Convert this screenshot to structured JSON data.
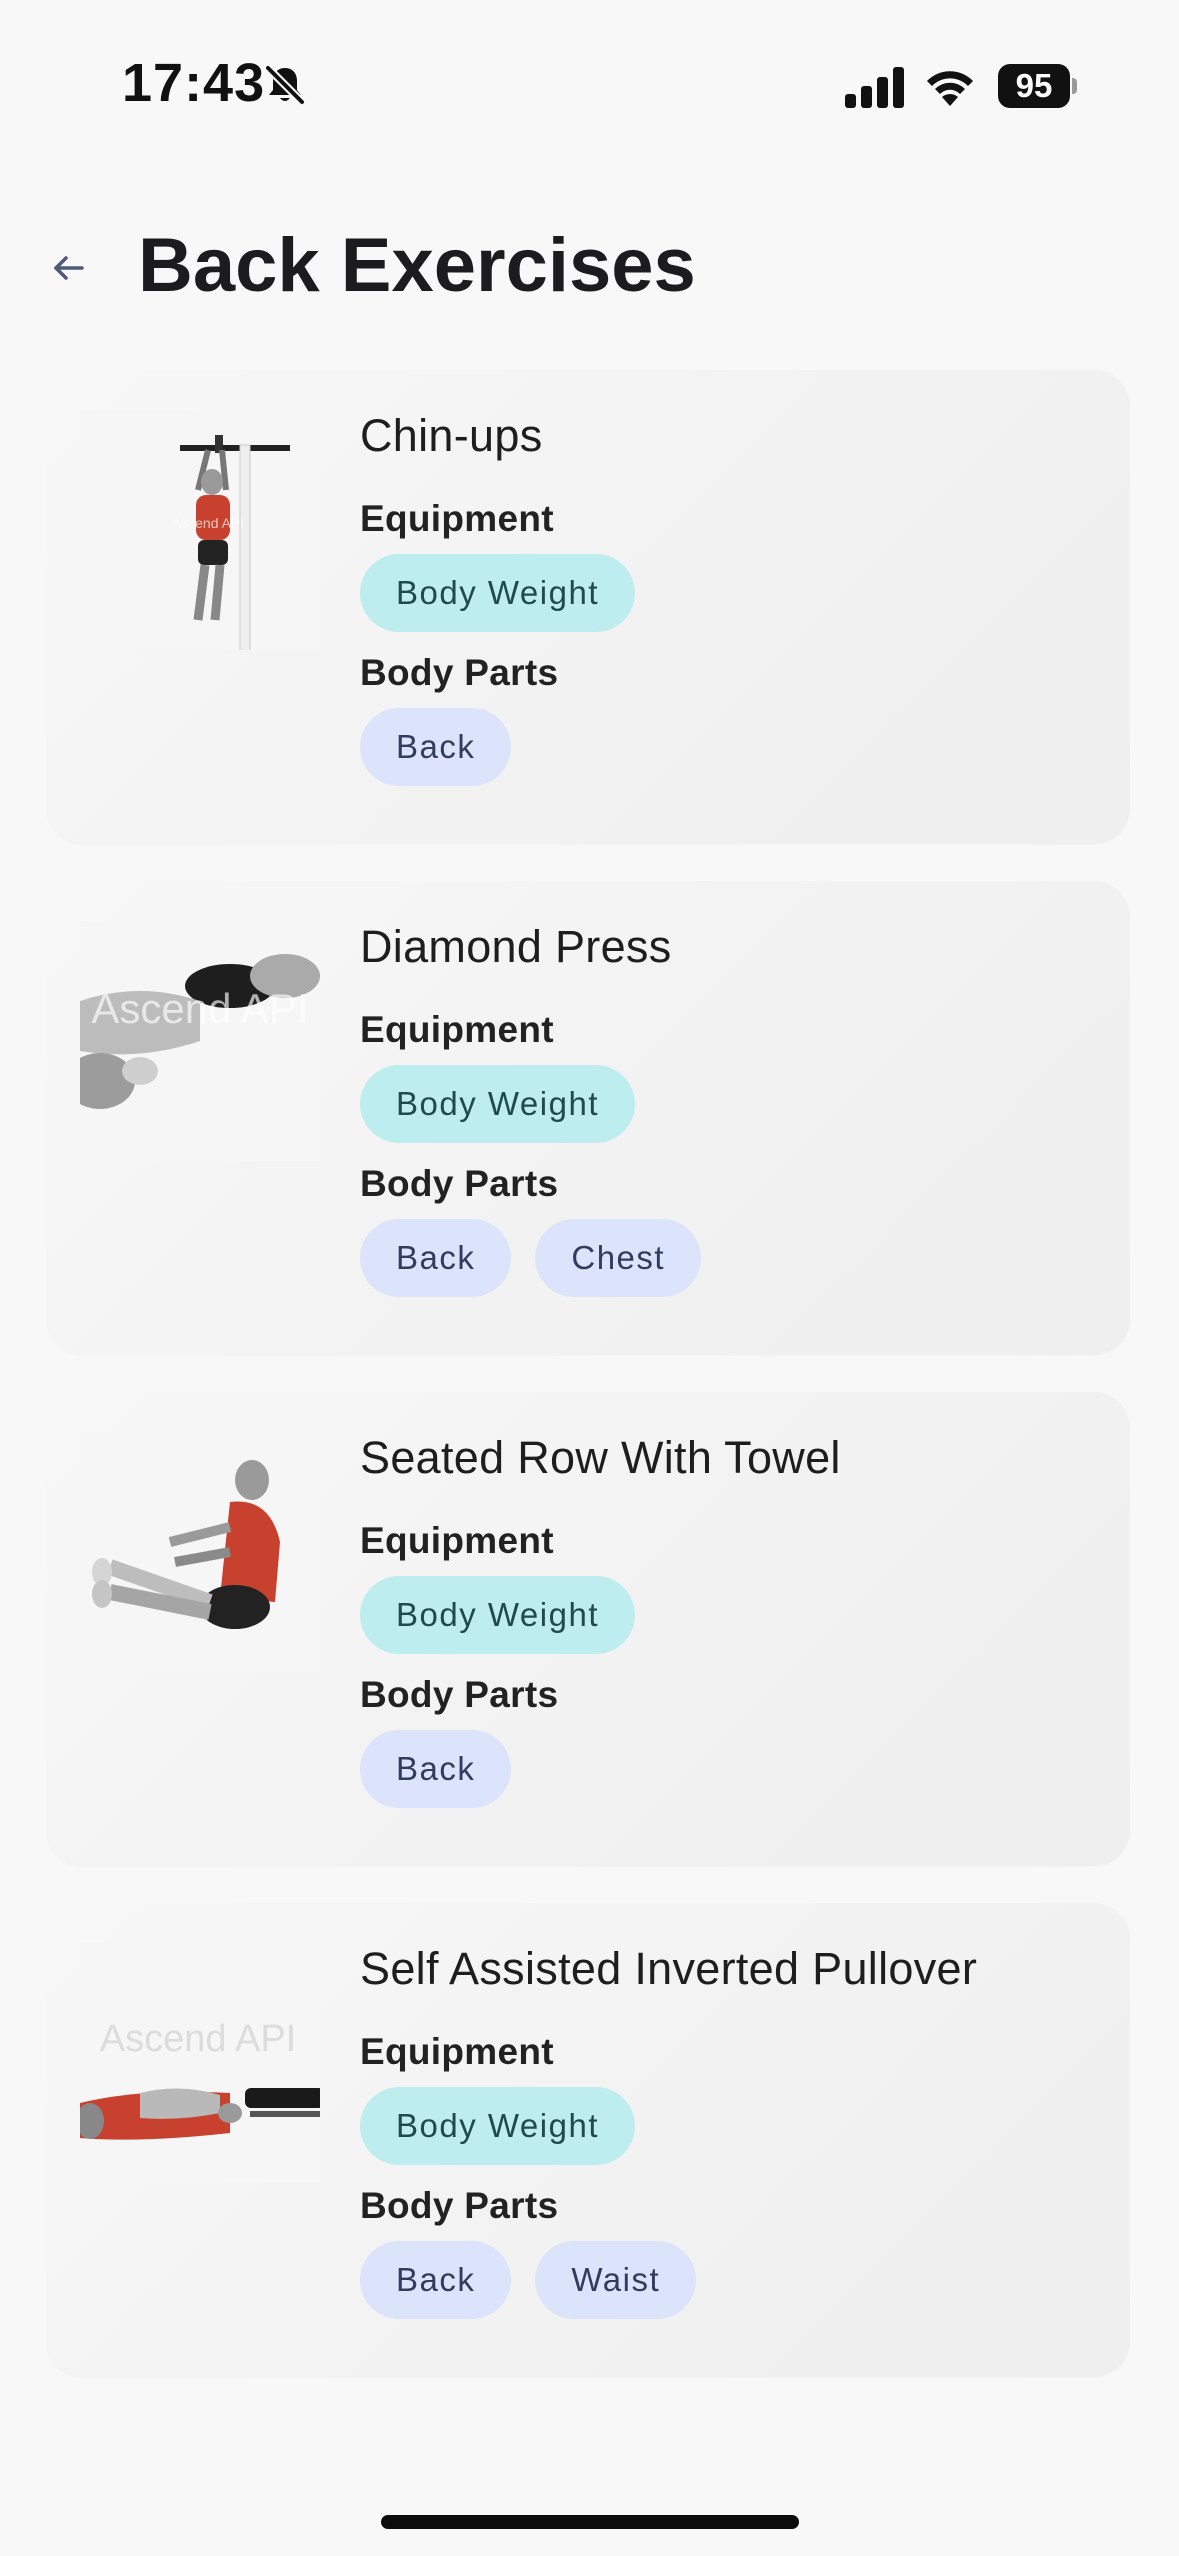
{
  "status_bar": {
    "time": "17:43",
    "battery": "95",
    "icons": [
      "bell-slash-icon",
      "cellular-signal-icon",
      "wifi-icon",
      "battery-icon"
    ]
  },
  "header": {
    "back_icon": "arrow-left-icon",
    "title": "Back Exercises"
  },
  "labels": {
    "equipment": "Equipment",
    "body_parts": "Body Parts"
  },
  "watermark": "Ascend API",
  "colors": {
    "equipment_chip_bg": "#bdedee",
    "bodypart_chip_bg": "#dbe4fb",
    "muscle_highlight": "#c8412e"
  },
  "exercises": [
    {
      "name": "Chin-ups",
      "equipment": [
        "Body Weight"
      ],
      "body_parts": [
        "Back"
      ]
    },
    {
      "name": "Diamond Press",
      "equipment": [
        "Body Weight"
      ],
      "body_parts": [
        "Back",
        "Chest"
      ]
    },
    {
      "name": "Seated Row With Towel",
      "equipment": [
        "Body Weight"
      ],
      "body_parts": [
        "Back"
      ]
    },
    {
      "name": "Self Assisted Inverted Pullover",
      "equipment": [
        "Body Weight"
      ],
      "body_parts": [
        "Back",
        "Waist"
      ]
    }
  ]
}
